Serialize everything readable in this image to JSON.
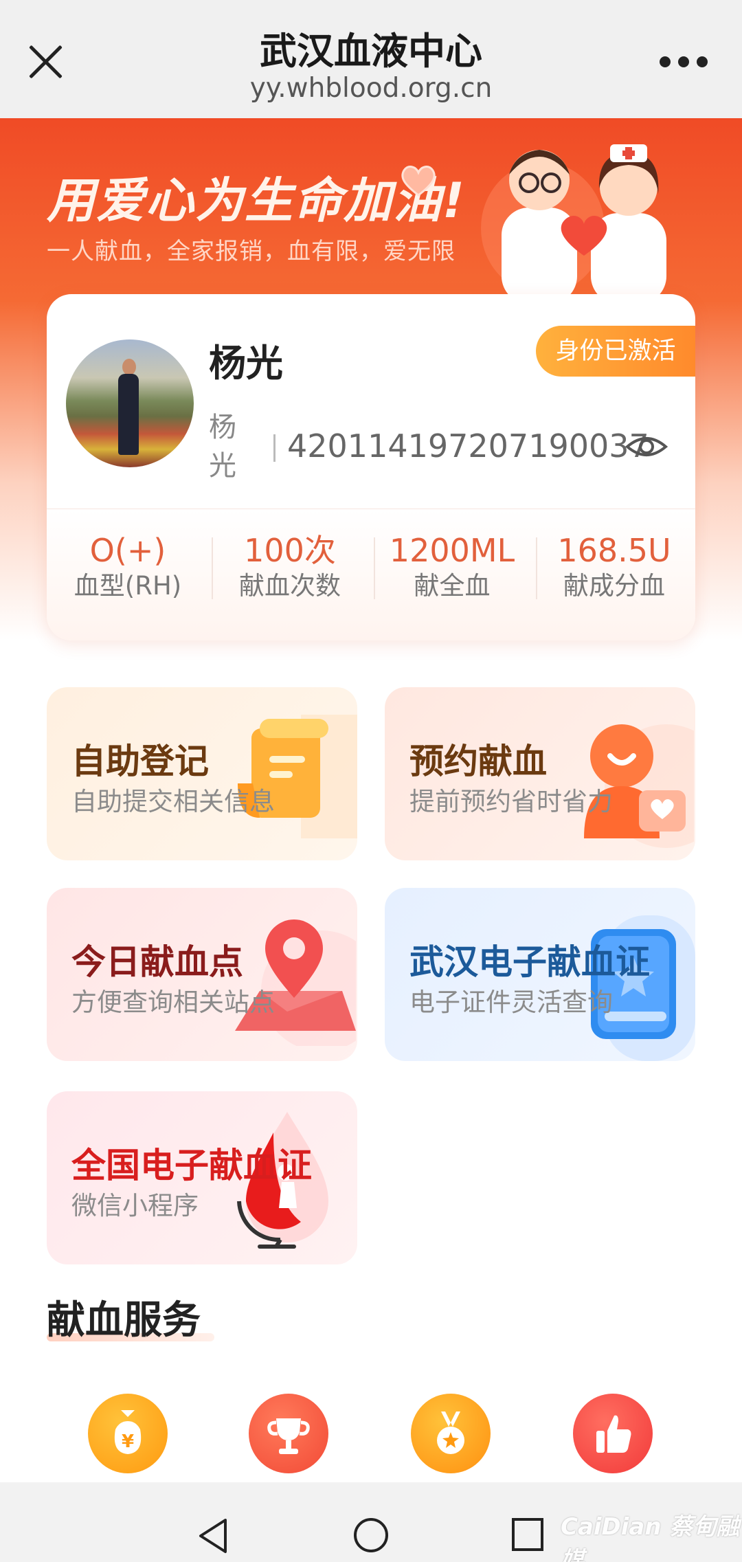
{
  "topbar": {
    "title": "武汉血液中心",
    "url": "yy.whblood.org.cn"
  },
  "hero": {
    "title": "用爱心为生命加油!",
    "subtitle": "一人献血，全家报销，血有限，爱无限"
  },
  "profile": {
    "name": "杨光",
    "status_badge": "身份已激活",
    "name_vertical": "杨光",
    "id_number": "420114197207190037",
    "stats": [
      {
        "value": "O(+)",
        "label": "血型(RH)"
      },
      {
        "value": "100次",
        "label": "献血次数"
      },
      {
        "value": "1200ML",
        "label": "献全血"
      },
      {
        "value": "168.5U",
        "label": "献成分血"
      }
    ]
  },
  "tiles": [
    {
      "title": "自助登记",
      "subtitle": "自助提交相关信息",
      "color": "#6b3a10"
    },
    {
      "title": "预约献血",
      "subtitle": "提前预约省时省力",
      "color": "#6b3a10"
    },
    {
      "title": "今日献血点",
      "subtitle": "方便查询相关站点",
      "color": "#8a1c1c"
    },
    {
      "title": "武汉电子献血证",
      "subtitle": "电子证件灵活查询",
      "color": "#1c5a9a"
    },
    {
      "title": "全国电子献血证",
      "subtitle": "微信小程序",
      "color": "#d81e1e"
    }
  ],
  "services": {
    "section_title": "献血服务"
  },
  "watermark": "CaiDian 蔡甸融媒",
  "colors": {
    "accent": "#f04b26",
    "badge": "#ff9a30",
    "stat": "#e2603c"
  }
}
